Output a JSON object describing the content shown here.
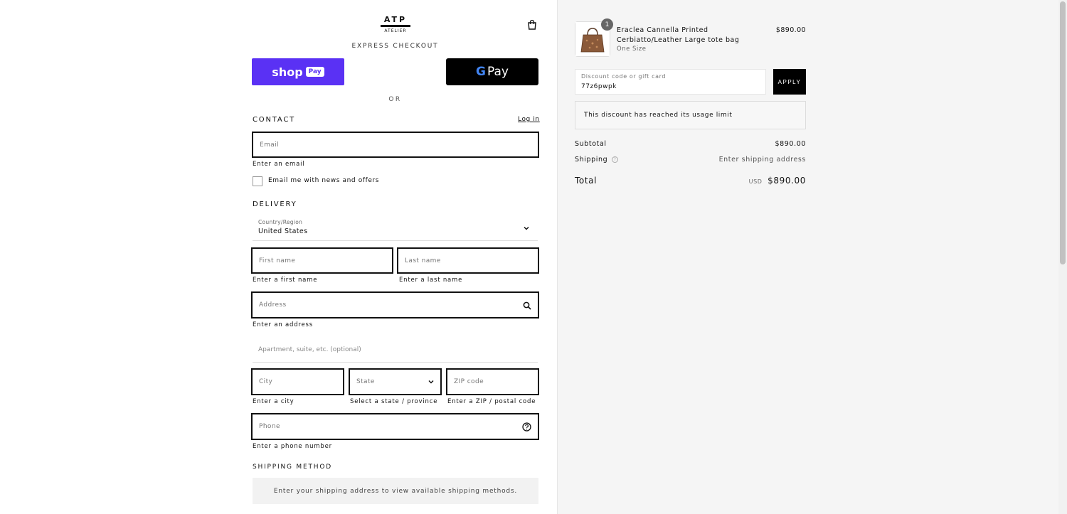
{
  "header": {
    "logo_top": "ATP",
    "logo_bottom": "ATELIER",
    "cart_icon": "shopping-bag-icon"
  },
  "express": {
    "title": "EXPRESS CHECKOUT",
    "shoppay_shop": "shop",
    "shoppay_pay": "Pay",
    "gpay_g": "G",
    "gpay_text": "Pay",
    "or": "OR"
  },
  "contact": {
    "title": "CONTACT",
    "login": "Log in",
    "email_placeholder": "Email",
    "email_error": "Enter an email",
    "newsletter_label": "Email me with news and offers"
  },
  "delivery": {
    "title": "DELIVERY",
    "country_label": "Country/Region",
    "country_value": "United States",
    "first_name_placeholder": "First name",
    "first_name_error": "Enter a first name",
    "last_name_placeholder": "Last name",
    "last_name_error": "Enter a last name",
    "address_placeholder": "Address",
    "address_error": "Enter an address",
    "apartment_placeholder": "Apartment, suite, etc. (optional)",
    "city_placeholder": "City",
    "city_error": "Enter a city",
    "state_placeholder": "State",
    "state_error": "Select a state / province",
    "zip_placeholder": "ZIP code",
    "zip_error": "Enter a ZIP / postal code",
    "phone_placeholder": "Phone",
    "phone_error": "Enter a phone number"
  },
  "shipping_method": {
    "title": "SHIPPING METHOD",
    "message": "Enter your shipping address to view available shipping methods."
  },
  "order": {
    "quantity": "1",
    "product_name": "Eraclea Cannella Printed Cerbiatto/Leather Large tote bag",
    "variant": "One Size",
    "price": "$890.00",
    "discount_label": "Discount code or gift card",
    "discount_value": "77z6pwpk",
    "apply": "APPLY",
    "discount_message": "This discount has reached its usage limit",
    "subtotal_label": "Subtotal",
    "subtotal_value": "$890.00",
    "shipping_label": "Shipping",
    "shipping_value": "Enter shipping address",
    "total_label": "Total",
    "total_currency": "USD",
    "total_value": "$890.00"
  }
}
